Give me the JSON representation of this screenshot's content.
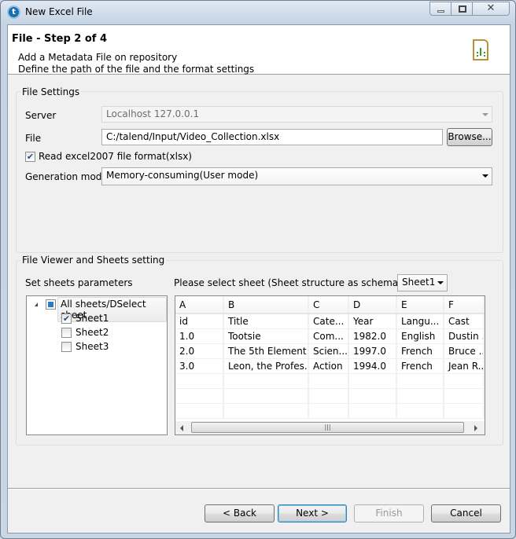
{
  "window": {
    "title": "New Excel File"
  },
  "header": {
    "title": "File - Step 2 of 4",
    "line1": "Add a Metadata File on repository",
    "line2": "Define the path of the file and the format settings"
  },
  "file_settings": {
    "label": "File Settings",
    "server_label": "Server",
    "server_value": "Localhost 127.0.0.1",
    "file_label": "File",
    "file_value": "C:/talend/Input/Video_Collection.xlsx",
    "browse_label": "Browse...",
    "xlsx_label": "Read excel2007 file format(xlsx)",
    "xlsx_checked": true,
    "gen_label": "Generation mode",
    "gen_value": "Memory-consuming(User mode)"
  },
  "viewer": {
    "label": "File Viewer and Sheets setting",
    "sheets_label": "Set sheets parameters",
    "tree_root": "All sheets/DSelect sheet",
    "sheets": [
      {
        "name": "Sheet1",
        "checked": true
      },
      {
        "name": "Sheet2",
        "checked": false
      },
      {
        "name": "Sheet3",
        "checked": false
      }
    ],
    "select_label": "Please select sheet (Sheet structure as schema guide)",
    "select_value": "Sheet1",
    "columns": [
      "A",
      "B",
      "C",
      "D",
      "E",
      "F"
    ],
    "rows": [
      [
        "id",
        "Title",
        "Cate...",
        "Year",
        "Langu...",
        "Cast"
      ],
      [
        "1.0",
        "Tootsie",
        "Com...",
        "1982.0",
        "English",
        "Dustin ..."
      ],
      [
        "2.0",
        "The 5th Element",
        "Scien...",
        "1997.0",
        "French",
        "Bruce ..."
      ],
      [
        "3.0",
        "Leon, the Profes...",
        "Action",
        "1994.0",
        "French",
        "Jean R..."
      ],
      [
        "",
        "",
        "",
        "",
        "",
        ""
      ],
      [
        "",
        "",
        "",
        "",
        "",
        ""
      ],
      [
        "",
        "",
        "",
        "",
        "",
        ""
      ]
    ]
  },
  "buttons": {
    "back": "< Back",
    "next": "Next >",
    "finish": "Finish",
    "cancel": "Cancel"
  }
}
